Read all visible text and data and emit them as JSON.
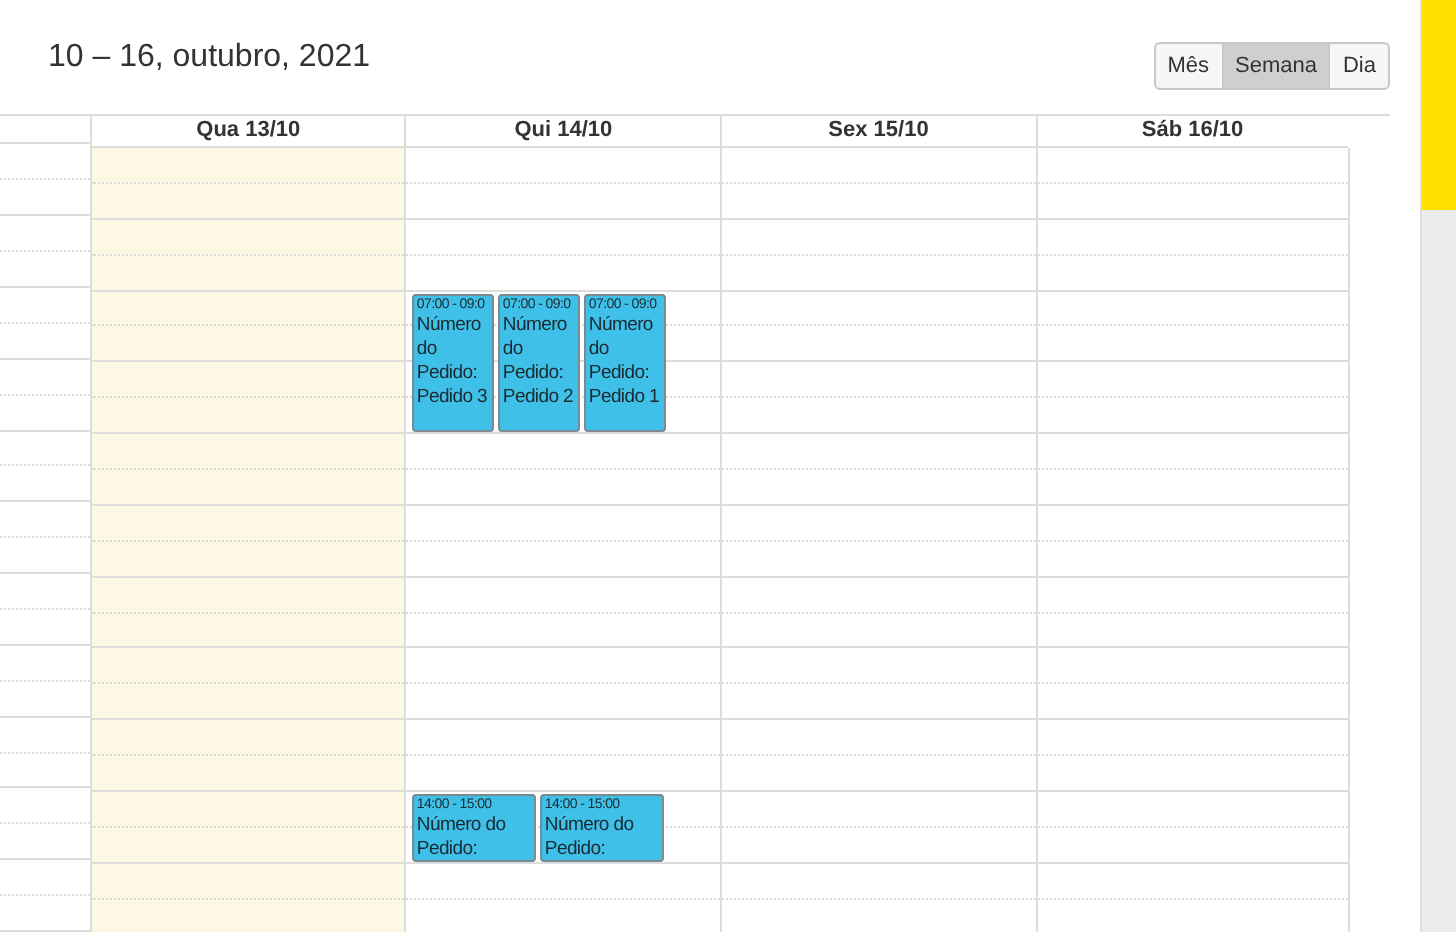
{
  "title": "10 – 16, outubro, 2021",
  "view_buttons": [
    {
      "label": "Mês",
      "selected": false
    },
    {
      "label": "Semana",
      "selected": true
    },
    {
      "label": "Dia",
      "selected": false
    }
  ],
  "days": [
    {
      "label": "Qua 13/10",
      "today": true
    },
    {
      "label": "Qui 14/10",
      "today": false,
      "events": [
        {
          "kind": "long",
          "time": "07:00 - 09:0",
          "text": "Número do Pedido: Pedido 3"
        },
        {
          "kind": "long",
          "time": "07:00 - 09:0",
          "text": "Número do Pedido: Pedido 2"
        },
        {
          "kind": "long",
          "time": "07:00 - 09:0",
          "text": "Número do Pedido: Pedido 1"
        },
        {
          "kind": "short",
          "time": "14:00 - 15:00",
          "text": "Número do Pedido:"
        },
        {
          "kind": "short",
          "time": "14:00 - 15:00",
          "text": "Número do Pedido:"
        }
      ]
    },
    {
      "label": "Sex 15/10",
      "today": false
    },
    {
      "label": "Sáb 16/10",
      "today": false
    }
  ]
}
